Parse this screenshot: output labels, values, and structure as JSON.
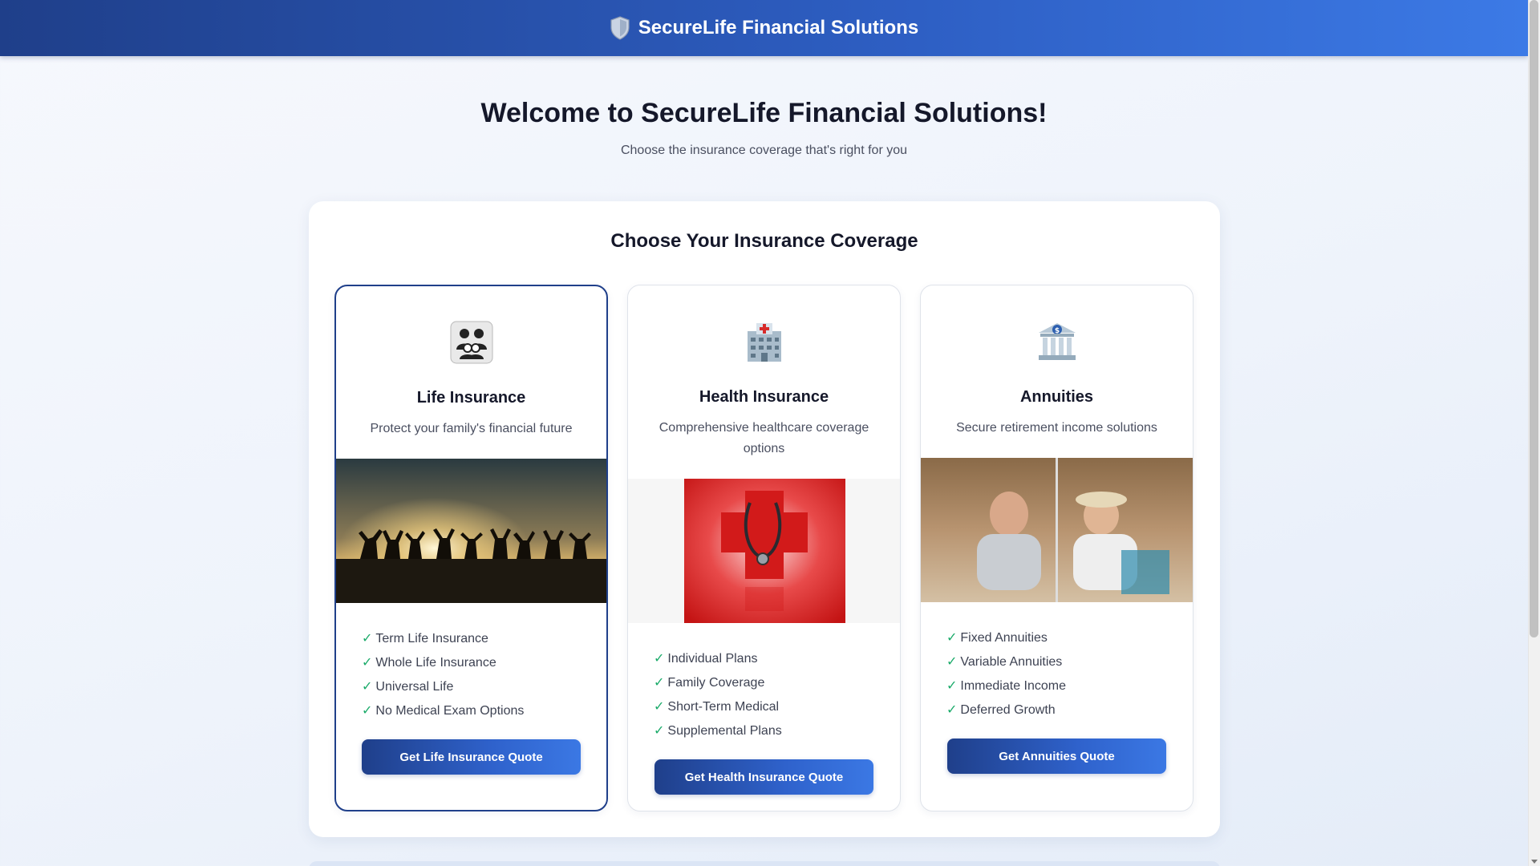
{
  "header": {
    "brand": "SecureLife Financial Solutions",
    "icon": "shield-icon"
  },
  "hero": {
    "title": "Welcome to SecureLife Financial Solutions!",
    "subtitle": "Choose the insurance coverage that's right for you"
  },
  "coverage": {
    "heading": "Choose Your Insurance Coverage",
    "cards": [
      {
        "title": "Life Insurance",
        "description": "Protect your family's financial future",
        "icon": "family-icon",
        "image": "people-jumping-at-sunset-photo",
        "features": [
          "Term Life Insurance",
          "Whole Life Insurance",
          "Universal Life",
          "No Medical Exam Options"
        ],
        "button": "Get Life Insurance Quote",
        "selected": true
      },
      {
        "title": "Health Insurance",
        "description": "Comprehensive healthcare coverage options",
        "icon": "hospital-icon",
        "image": "red-cross-stethoscope-photo",
        "features": [
          "Individual Plans",
          "Family Coverage",
          "Short-Term Medical",
          "Supplemental Plans"
        ],
        "button": "Get Health Insurance Quote",
        "selected": false
      },
      {
        "title": "Annuities",
        "description": "Secure retirement income solutions",
        "icon": "bank-icon",
        "image": "retired-couple-beach-photo",
        "features": [
          "Fixed Annuities",
          "Variable Annuities",
          "Immediate Income",
          "Deferred Growth"
        ],
        "button": "Get Annuities Quote",
        "selected": false
      }
    ]
  },
  "check_glyph": "✓",
  "colors": {
    "primary": "#1f3f8a",
    "accent": "#3c7ae6",
    "check": "#1bab6a"
  }
}
